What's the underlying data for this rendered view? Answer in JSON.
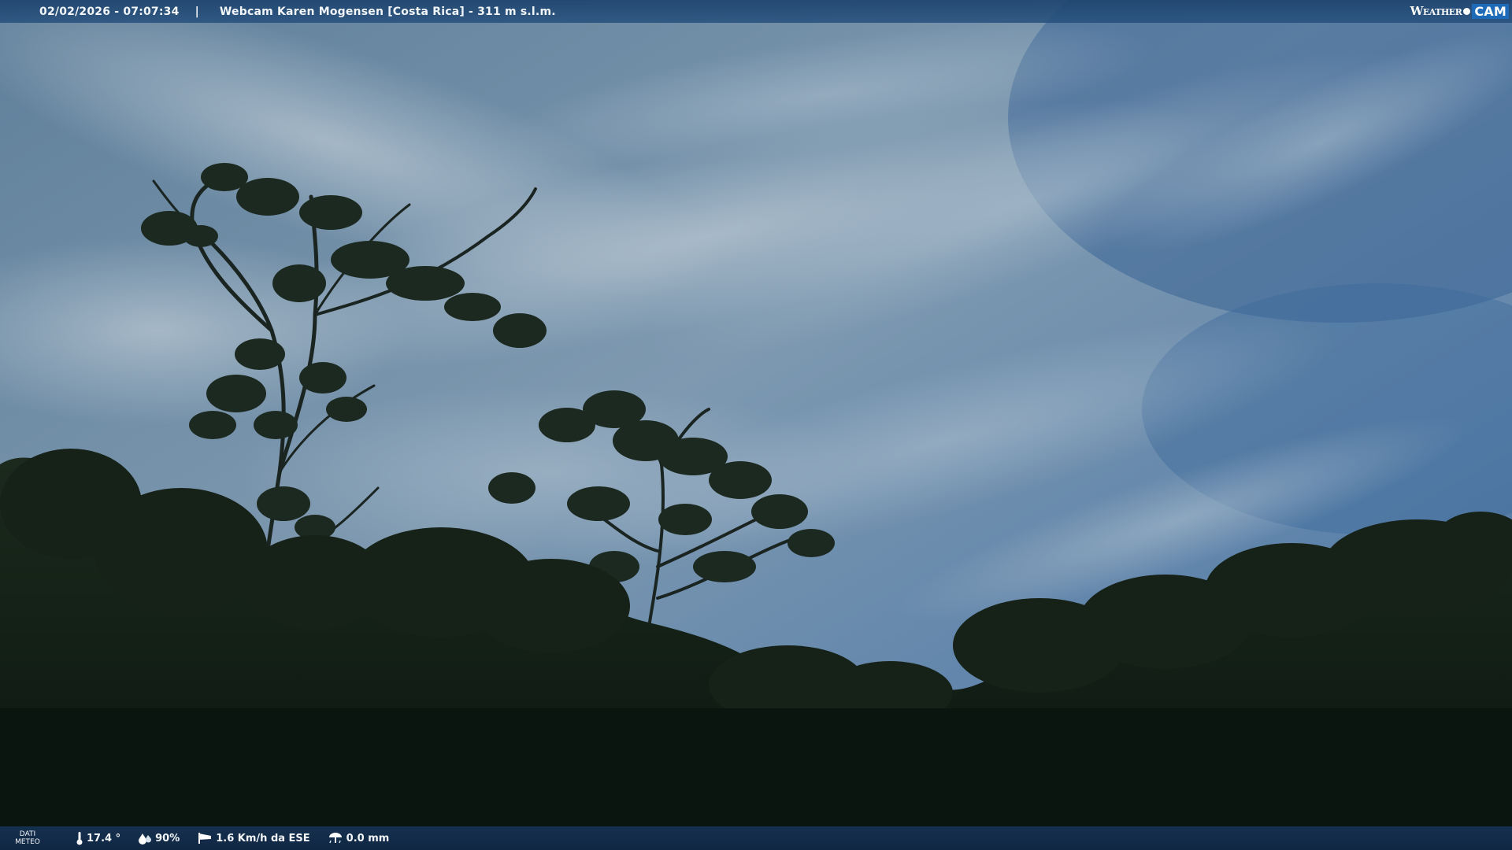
{
  "header": {
    "datetime": "02/02/2026 - 07:07:34",
    "separator": "|",
    "title": "Webcam Karen Mogensen [Costa Rica]  - 311 m s.l.m."
  },
  "brand": {
    "weather": "Weather",
    "cam": "CAM"
  },
  "footer": {
    "dati_line1": "DATI",
    "dati_line2": "METEO",
    "temperature": "17.4 °",
    "humidity": "90%",
    "wind": "1.6 Km/h da ESE",
    "rain": "0.0 mm"
  },
  "icons": {
    "temperature": "thermometer-icon",
    "humidity": "humidity-drop-icon",
    "wind": "windsock-icon",
    "rain": "rain-gauge-icon"
  },
  "colors": {
    "bar": "#1e446e",
    "sky_top": "#3f6f9e",
    "sky_bottom": "#8fa8bd",
    "foliage": "#0f1a12"
  }
}
